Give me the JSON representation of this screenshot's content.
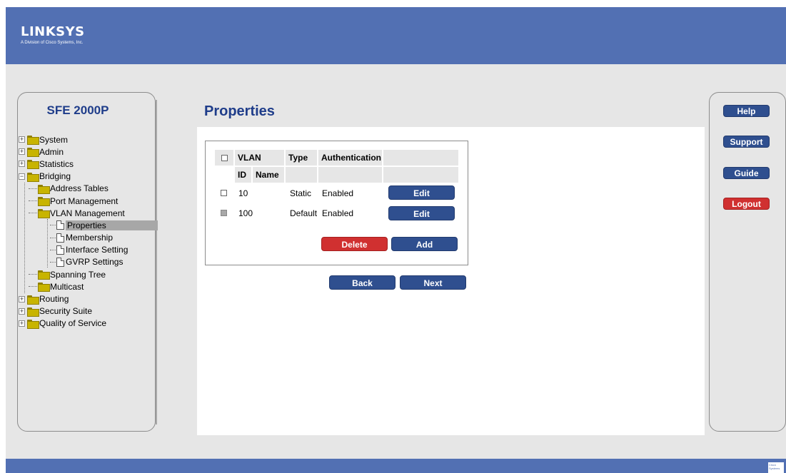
{
  "brand": {
    "name": "LINKSYS",
    "tagline": "A Division of Cisco Systems, Inc."
  },
  "device": {
    "title": "SFE 2000P"
  },
  "page": {
    "title": "Properties"
  },
  "nav": {
    "items": [
      {
        "label": "System",
        "level": 0,
        "kind": "folder",
        "expanded": false
      },
      {
        "label": "Admin",
        "level": 0,
        "kind": "folder",
        "expanded": false
      },
      {
        "label": "Statistics",
        "level": 0,
        "kind": "folder",
        "expanded": false
      },
      {
        "label": "Bridging",
        "level": 0,
        "kind": "folder",
        "expanded": true
      },
      {
        "label": "Address Tables",
        "level": 1,
        "kind": "folder"
      },
      {
        "label": "Port Management",
        "level": 1,
        "kind": "folder"
      },
      {
        "label": "VLAN Management",
        "level": 1,
        "kind": "folder"
      },
      {
        "label": "Properties",
        "level": 2,
        "kind": "page",
        "selected": true
      },
      {
        "label": "Membership",
        "level": 2,
        "kind": "page"
      },
      {
        "label": "Interface Setting",
        "level": 2,
        "kind": "page"
      },
      {
        "label": "GVRP Settings",
        "level": 2,
        "kind": "page"
      },
      {
        "label": "Spanning Tree",
        "level": 1,
        "kind": "folder"
      },
      {
        "label": "Multicast",
        "level": 1,
        "kind": "folder"
      },
      {
        "label": "Routing",
        "level": 0,
        "kind": "folder",
        "expanded": false
      },
      {
        "label": "Security Suite",
        "level": 0,
        "kind": "folder",
        "expanded": false
      },
      {
        "label": "Quality of Service",
        "level": 0,
        "kind": "folder",
        "expanded": false
      }
    ]
  },
  "table": {
    "headers": {
      "vlan": "VLAN",
      "type": "Type",
      "authentication": "Authentication",
      "id": "ID",
      "name": "Name"
    },
    "rows": [
      {
        "id": "10",
        "name": "",
        "type": "Static",
        "authentication": "Enabled",
        "action": "Edit",
        "selectable": true
      },
      {
        "id": "100",
        "name": "",
        "type": "Default",
        "authentication": "Enabled",
        "action": "Edit",
        "selectable": false
      }
    ],
    "buttons": {
      "delete": "Delete",
      "add": "Add"
    }
  },
  "footer_buttons": {
    "back": "Back",
    "next": "Next"
  },
  "side_buttons": {
    "help": "Help",
    "support": "Support",
    "guide": "Guide",
    "logout": "Logout"
  },
  "corner": {
    "text": "Cisco Systems"
  },
  "colors": {
    "header_bar": "#5270b3",
    "title_blue": "#1f3d8a",
    "button_blue": "#2f4f8f",
    "button_red": "#d03030"
  }
}
